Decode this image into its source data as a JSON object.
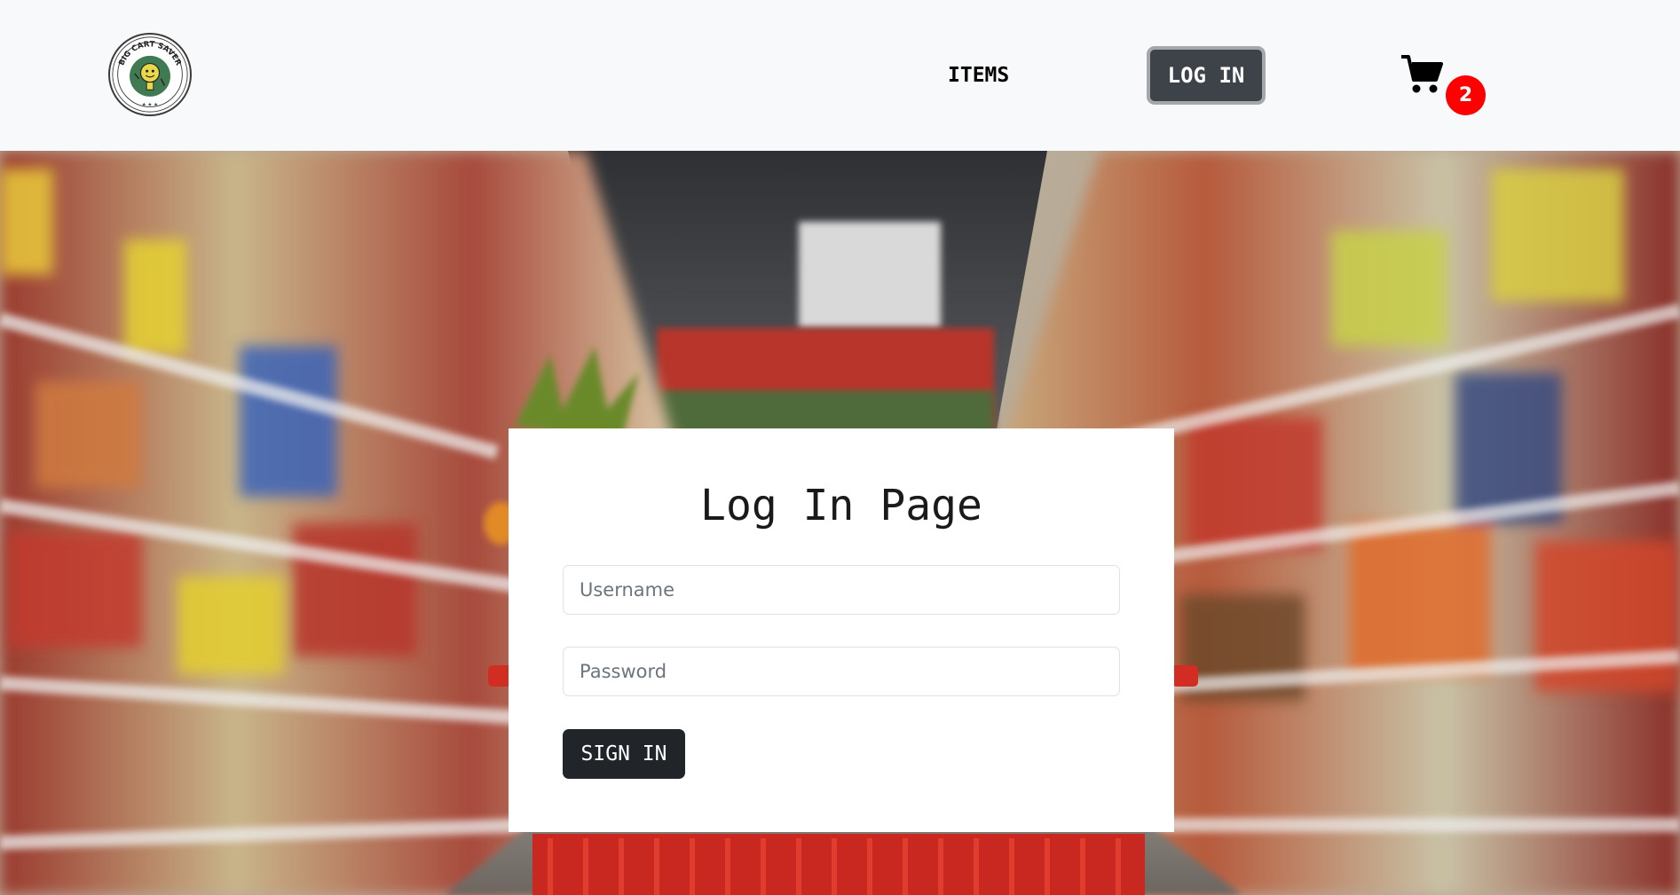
{
  "navbar": {
    "logo_text": "BIG CART SAVER",
    "items_link": "ITEMS",
    "login_button": "LOG IN",
    "cart_icon": "shopping-cart-icon",
    "cart_count": "2"
  },
  "hero": {
    "image": "supermarket-aisle-shopping-basket"
  },
  "login_form": {
    "title": "Log In Page",
    "username_placeholder": "Username",
    "username_value": "",
    "password_placeholder": "Password",
    "password_value": "",
    "submit_label": "SIGN IN"
  },
  "colors": {
    "navbar_bg": "#f8f9fa",
    "login_button_bg": "#3d4349",
    "badge": "#ff0000",
    "submit_bg": "#212529"
  }
}
